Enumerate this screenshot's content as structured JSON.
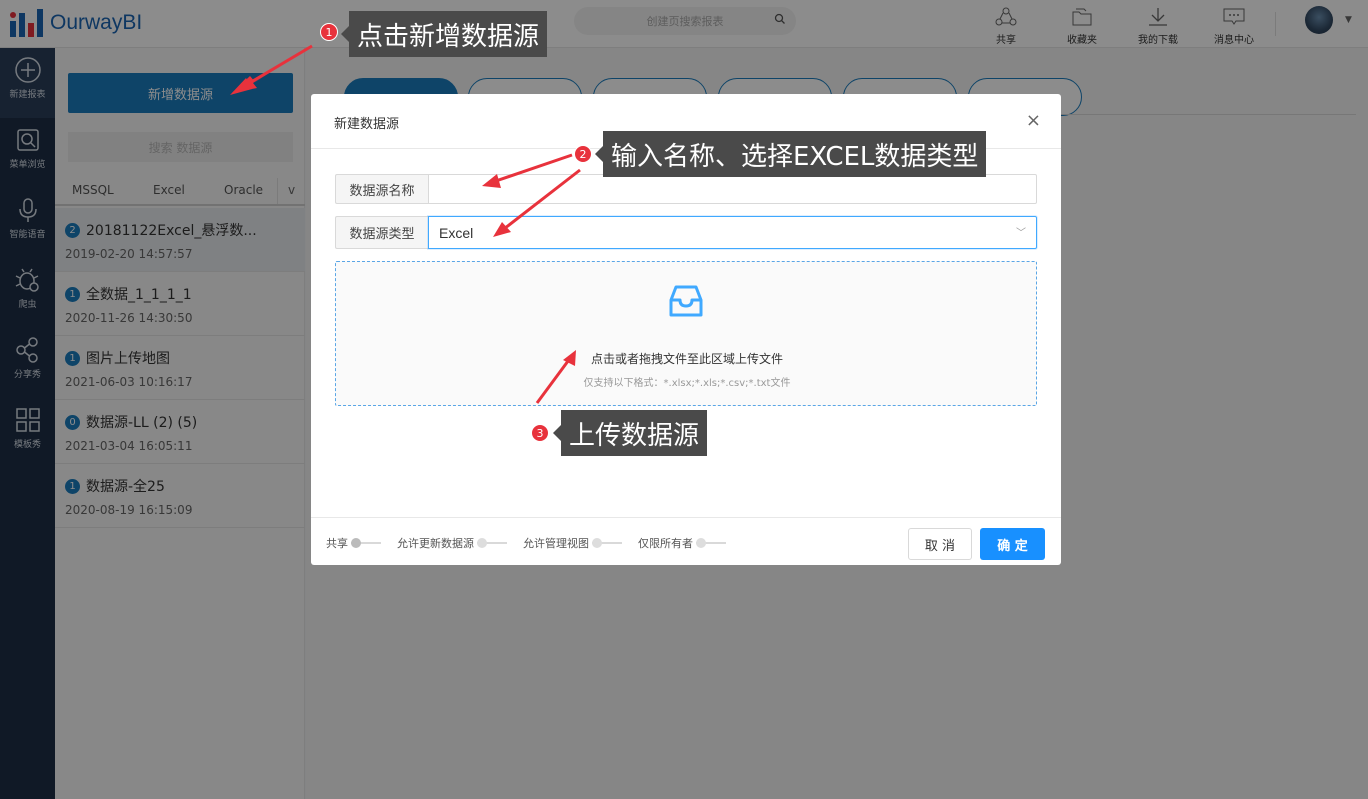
{
  "topbar": {
    "logo_text": "OurwayBI",
    "search_placeholder": "创建页搜索报表",
    "icons": [
      {
        "name": "share",
        "label": "共享"
      },
      {
        "name": "favorites",
        "label": "收藏夹"
      },
      {
        "name": "downloads",
        "label": "我的下载"
      },
      {
        "name": "messages",
        "label": "消息中心"
      }
    ]
  },
  "leftnav": {
    "items": [
      {
        "icon": "plus-circle-icon",
        "label": "新建报表"
      },
      {
        "icon": "search-menu-icon",
        "label": "菜单浏览"
      },
      {
        "icon": "microphone-icon",
        "label": "智能语音"
      },
      {
        "icon": "bug-icon",
        "label": "爬虫"
      },
      {
        "icon": "share-nodes-icon",
        "label": "分享秀"
      },
      {
        "icon": "grid-icon",
        "label": "模板秀"
      }
    ]
  },
  "sidebar": {
    "add_button": "新增数据源",
    "search_placeholder": "搜索 数据源",
    "tabs": [
      "MSSQL",
      "Excel",
      "Oracle"
    ],
    "tabs_more": "v",
    "items": [
      {
        "badge": "2",
        "title": "20181122Excel_悬浮数...",
        "time": "2019-02-20 14:57:57"
      },
      {
        "badge": "1",
        "title": "全数据_1_1_1_1",
        "time": "2020-11-26 14:30:50"
      },
      {
        "badge": "1",
        "title": "图片上传地图",
        "time": "2021-06-03 10:16:17"
      },
      {
        "badge": "0",
        "title": "数据源-LL (2) (5)",
        "time": "2021-03-04 16:05:11"
      },
      {
        "badge": "1",
        "title": "数据源-全25",
        "time": "2020-08-19 16:15:09"
      }
    ]
  },
  "modal": {
    "title": "新建数据源",
    "close": "×",
    "name_label": "数据源名称",
    "name_value": "",
    "type_label": "数据源类型",
    "type_value": "Excel",
    "upload_text": "点击或者拖拽文件至此区域上传文件",
    "upload_hint": "仅支持以下格式：*.xlsx;*.xls;*.csv;*.txt文件",
    "switches": [
      "共享",
      "允许更新数据源",
      "允许管理视图",
      "仅限所有者"
    ],
    "cancel": "取 消",
    "ok": "确 定"
  },
  "annotations": {
    "step1": {
      "num": "1",
      "text": "点击新增数据源"
    },
    "step2": {
      "num": "2",
      "text": "输入名称、选择EXCEL数据类型"
    },
    "step3": {
      "num": "3",
      "text": "上传数据源"
    }
  },
  "colors": {
    "primary": "#1b7cbe",
    "button_ok": "#1890ff",
    "nav_bg": "#1e2f45",
    "step_badge": "#e8323c",
    "callout_bg": "#4a4a4a"
  }
}
